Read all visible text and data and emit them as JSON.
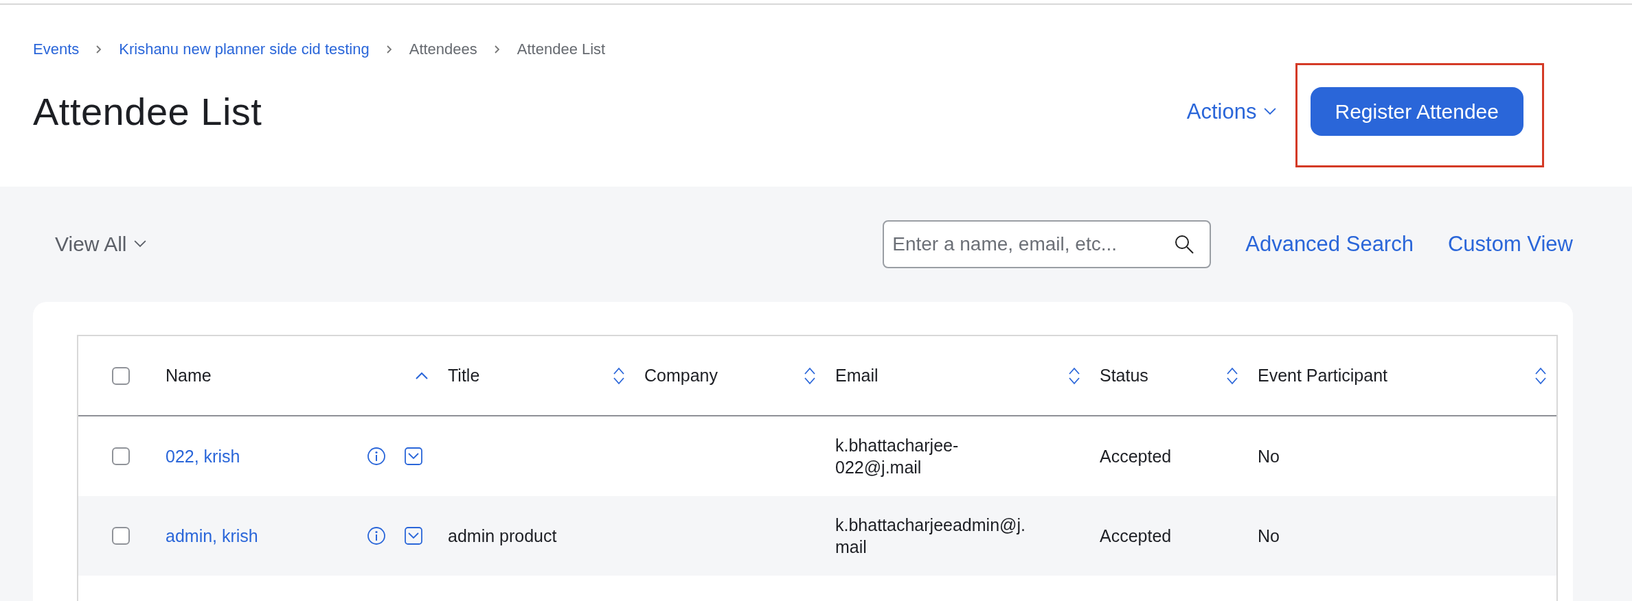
{
  "breadcrumb": [
    {
      "label": "Events",
      "link": true
    },
    {
      "label": "Krishanu new planner side cid testing",
      "link": true
    },
    {
      "label": "Attendees",
      "link": false
    },
    {
      "label": "Attendee List",
      "link": false
    }
  ],
  "page_title": "Attendee List",
  "actions_menu": "Actions",
  "register_button": {
    "label": "Register Attendee",
    "highlighted": true
  },
  "toolbar": {
    "view_menu": "View All",
    "search": {
      "placeholder": "Enter a name, email, etc..."
    },
    "links": [
      "Advanced Search",
      "Custom View"
    ]
  },
  "table": {
    "select_all": {
      "checked": false
    },
    "columns": [
      {
        "label": "Name",
        "sorted": true
      },
      {
        "label": "Title",
        "sorted": false
      },
      {
        "label": "Company",
        "sorted": false
      },
      {
        "label": "Email",
        "sorted": false
      },
      {
        "label": "Status",
        "sorted": false
      },
      {
        "label": "Event Participant",
        "sorted": false
      }
    ],
    "rows": [
      {
        "checked": false,
        "name": "022, krish",
        "email": "k.bhattacharjee-022@j.mail",
        "status": "Accepted",
        "event_participant": "No"
      },
      {
        "checked": false,
        "name": "admin, krish",
        "title": "admin product",
        "email": "k.bhattacharjeeadmin@j.mail",
        "status": "Accepted",
        "event_participant": "No"
      }
    ]
  }
}
